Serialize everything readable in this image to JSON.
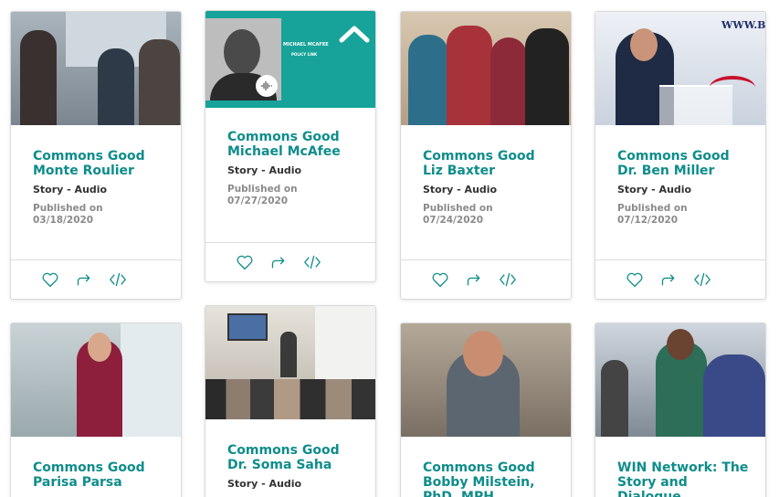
{
  "colors": {
    "accent": "#0e8d8b",
    "thumb_teal": "#17a39a"
  },
  "icons": [
    "heart-icon",
    "share-icon",
    "embed-code-icon",
    "chevron-up-icon",
    "audio-logo-icon"
  ],
  "cards": [
    {
      "title_line1": "Commons Good",
      "title_line2": "Monte Roulier",
      "type": "Story - Audio",
      "published_label": "Published on",
      "date": "03/18/2020"
    },
    {
      "title_line1": "Commons Good",
      "title_line2": "Michael McAfee",
      "type": "Story - Audio",
      "published_label": "Published on",
      "date": "07/27/2020",
      "thumb_name": "MICHAEL MCAFEE",
      "thumb_org": "POLICY LINK"
    },
    {
      "title_line1": "Commons Good",
      "title_line2": "Liz Baxter",
      "type": "Story - Audio",
      "published_label": "Published on",
      "date": "07/24/2020"
    },
    {
      "title_line1": "Commons Good",
      "title_line2": "Dr. Ben Miller",
      "type": "Story - Audio",
      "published_label": "Published on",
      "date": "07/12/2020",
      "thumb_text": "WWW.BI"
    },
    {
      "title_line1": "Commons Good",
      "title_line2": "Parisa Parsa"
    },
    {
      "title_line1": "Commons Good",
      "title_line2": "Dr. Soma Saha",
      "type": "Story - Audio"
    },
    {
      "title_line1": "Commons Good",
      "title_line2": "Bobby Milstein,",
      "title_line3": "PhD, MPH"
    },
    {
      "title_line1": "WIN Network: The",
      "title_line2": "Story and",
      "title_line3": "Dialogue"
    }
  ]
}
